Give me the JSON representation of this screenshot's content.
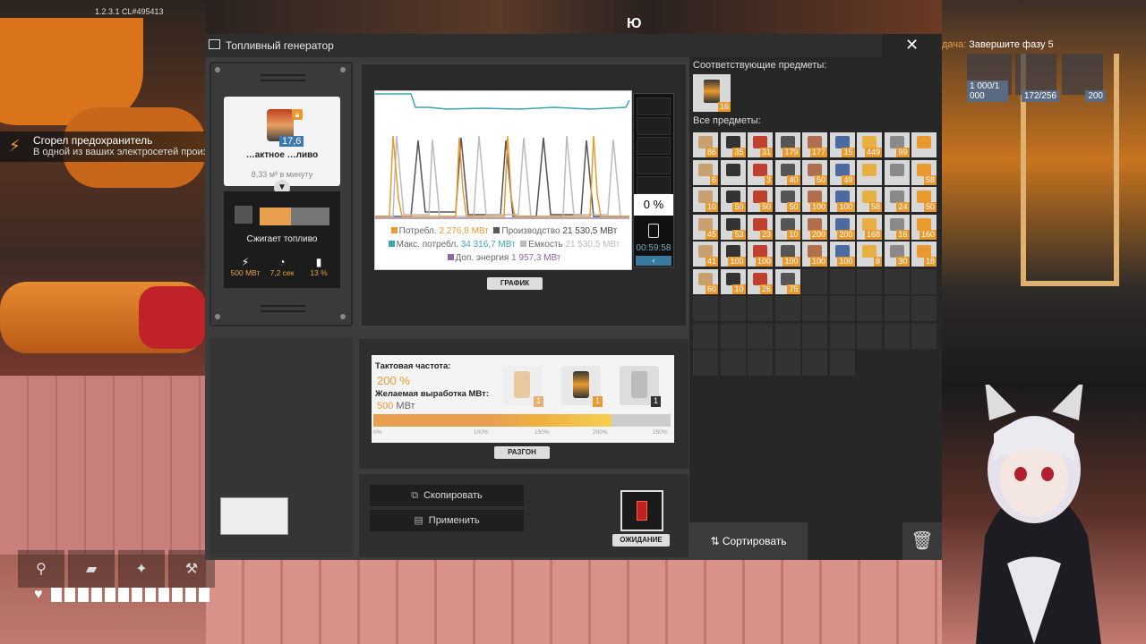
{
  "hud": {
    "version": "1.2.3.1 CL#495413",
    "key_hint": "Ю",
    "notification": {
      "title": "Сгорел предохранитель",
      "text": "В одной из ваших электросетей произошёл сбой!"
    },
    "task": {
      "prefix": "дача:",
      "text": "Завершите фазу 5"
    },
    "task_items": [
      {
        "count": "1 000/1 000"
      },
      {
        "count": "172/256"
      },
      {
        "count": "200"
      }
    ]
  },
  "window": {
    "title": "Топливный генератор",
    "close_label": "✕",
    "fuel": {
      "count": "17,6",
      "name": "…актное …ливо",
      "rate": "8,33 м³ в минуту"
    },
    "burn": {
      "label": "Сжигает топливо"
    },
    "stats": [
      {
        "icon": "⚡",
        "value": "500 МВт"
      },
      {
        "icon": "◔",
        "value": "7,2 сек"
      },
      {
        "icon": "▮",
        "value": "13 %"
      }
    ],
    "graph": {
      "legend": {
        "consumption_label": "Потребл.",
        "consumption_value": "2 276,8 МВт",
        "production_label": "Производство",
        "production_value": "21 530,5 МВт",
        "max_label": "Макс. потребл.",
        "max_value": "34 316,7 МВт",
        "capacity_label": "Емкость",
        "capacity_value": "21 530,5 МВт",
        "extra_label": "Доп. энергия",
        "extra_value": "1 957,3 МВт"
      },
      "meter_percent": "0 %",
      "meter_time": "00:59:58",
      "tab_label": "ГРАФИК"
    },
    "overclock": {
      "clock_label": "Тактовая частота:",
      "clock_value": "200 %",
      "output_label": "Желаемая выработка МВт:",
      "output_value": "500",
      "output_unit": "МВт",
      "slot_badges": [
        "1",
        "1",
        "1"
      ],
      "fill_percent": 200,
      "ticks": [
        "0%",
        "100%",
        "150%",
        "200%",
        "250%"
      ],
      "tab_label": "РАЗГОН"
    },
    "actions": {
      "copy": "Скопировать",
      "paste": "Применить",
      "standby": "ОЖИДАНИЕ"
    },
    "items": {
      "matching_label": "Соответствующие предметы:",
      "matching_count": "16",
      "all_label": "Все предметы:",
      "counts": [
        "86",
        "35",
        "31",
        "179",
        "177",
        "15",
        "449",
        "99",
        "",
        "6",
        "",
        "3",
        "40",
        "50",
        "49",
        "",
        "",
        "58",
        "10",
        "50",
        "50",
        "50",
        "100",
        "100",
        "58",
        "24",
        "50",
        "45",
        "53",
        "23",
        "10",
        "200",
        "200",
        "168",
        "16",
        "160",
        "41",
        "100",
        "100",
        "100",
        "100",
        "100",
        "8",
        "30",
        "18",
        "60",
        "10",
        "26",
        "75"
      ],
      "sort_label": "Сортировать"
    }
  }
}
